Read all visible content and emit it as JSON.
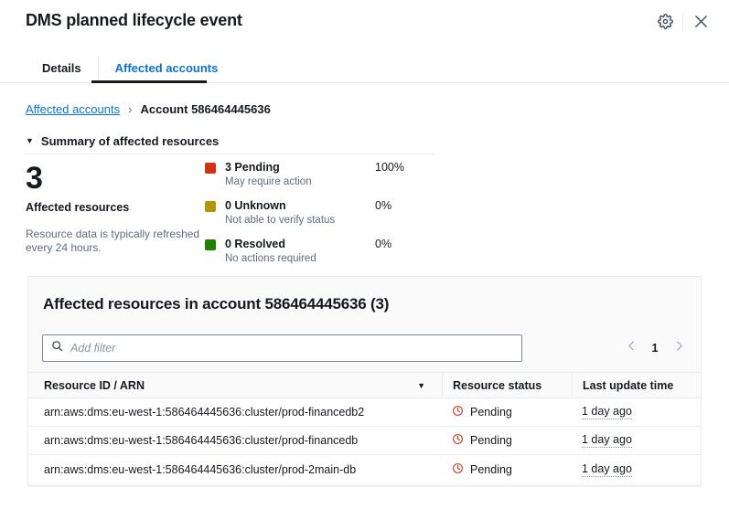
{
  "header": {
    "title": "DMS planned lifecycle event",
    "settings_icon": "gear-icon",
    "close_icon": "close-icon"
  },
  "tabs": [
    {
      "label": "Details",
      "active": false
    },
    {
      "label": "Affected accounts",
      "active": true
    }
  ],
  "breadcrumb": {
    "root": "Affected accounts",
    "separator": "›",
    "current": "Account 586464445636"
  },
  "summary": {
    "section_title": "Summary of affected resources",
    "caret": "▼",
    "count": "3",
    "count_label": "Affected resources",
    "note": "Resource data is typically refreshed every 24 hours.",
    "stats": [
      {
        "label": "3 Pending",
        "sub": "May require action",
        "percent": "100%",
        "color": "#d13212"
      },
      {
        "label": "0 Unknown",
        "sub": "Not able to verify status",
        "percent": "0%",
        "color": "#b7950b"
      },
      {
        "label": "0 Resolved",
        "sub": "No actions required",
        "percent": "0%",
        "color": "#1d8102"
      }
    ]
  },
  "panel": {
    "title": "Affected resources in account 586464445636 (3)",
    "filter": {
      "placeholder": "Add filter",
      "value": "",
      "icon": "search-icon"
    },
    "pagination": {
      "prev_icon": "chevron-left-icon",
      "page": "1",
      "next_icon": "chevron-right-icon"
    },
    "table": {
      "columns": [
        {
          "label": "Resource ID / ARN",
          "sort_icon": "▼"
        },
        {
          "label": "Resource status"
        },
        {
          "label": "Last update time"
        }
      ],
      "rows": [
        {
          "arn": "arn:aws:dms:eu-west-1:586464445636:cluster/prod-financedb2",
          "status": "Pending",
          "status_icon": "pending-clock-icon",
          "updated": "1 day ago"
        },
        {
          "arn": "arn:aws:dms:eu-west-1:586464445636:cluster/prod-financedb",
          "status": "Pending",
          "status_icon": "pending-clock-icon",
          "updated": "1 day ago"
        },
        {
          "arn": "arn:aws:dms:eu-west-1:586464445636:cluster/prod-2main-db",
          "status": "Pending",
          "status_icon": "pending-clock-icon",
          "updated": "1 day ago"
        }
      ]
    }
  },
  "colors": {
    "link": "#0972d3",
    "pending": "#d13212",
    "unknown": "#b7950b",
    "resolved": "#1d8102",
    "text": "#16191f",
    "muted": "#5f6b7a"
  }
}
